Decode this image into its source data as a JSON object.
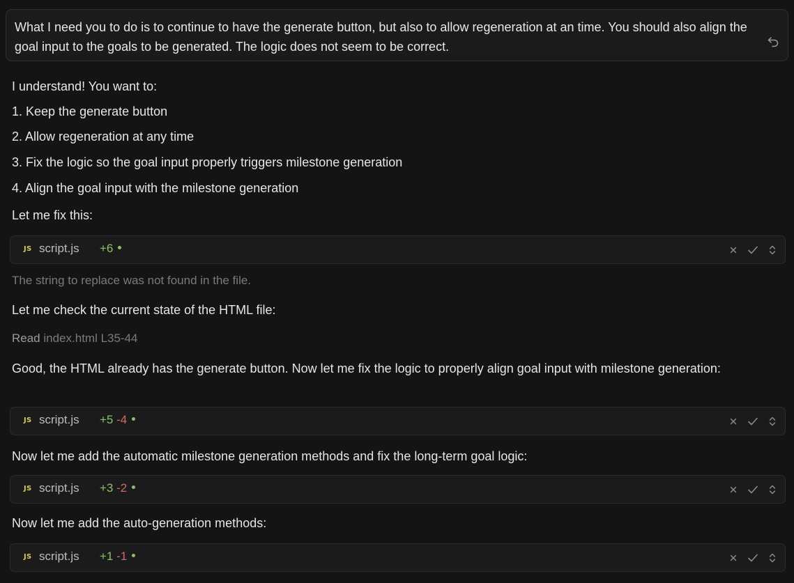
{
  "user_message": {
    "text": "What I need you to do is to continue to have the generate button, but also to allow regeneration at an time. You should also align the goal input to the goals to be generated. The logic does not seem to be correct."
  },
  "assistant": {
    "intro": "I understand! You want to:",
    "list": [
      "1. Keep the generate button",
      "2. Allow regeneration at any time",
      "3. Fix the logic so the goal input properly triggers milestone generation",
      "4. Align the goal input with the milestone generation"
    ],
    "fix_intro": "Let me fix this:",
    "error_text": "The string to replace was not found in the file.",
    "check_text": "Let me check the current state of the HTML file:",
    "read": {
      "verb": "Read",
      "file": "index.html L35-44"
    },
    "good_text": "Good, the HTML already has the generate button. Now let me fix the logic to properly align goal input with milestone generation:",
    "add_methods_text": "Now let me add the automatic milestone generation methods and fix the long-term goal logic:",
    "auto_gen_text": "Now let me add the auto-generation methods:"
  },
  "edits": [
    {
      "badge": "JS",
      "file": "script.js",
      "added": "+6",
      "removed": ""
    },
    {
      "badge": "JS",
      "file": "script.js",
      "added": "+5",
      "removed": "-4"
    },
    {
      "badge": "JS",
      "file": "script.js",
      "added": "+3",
      "removed": "-2"
    },
    {
      "badge": "JS",
      "file": "script.js",
      "added": "+1",
      "removed": "-1"
    }
  ],
  "icons": {
    "undo": "undo-icon",
    "reject": "close-icon",
    "accept": "check-icon",
    "expand": "expand-icon"
  },
  "colors": {
    "background": "#141414",
    "added": "#8cc06b",
    "removed": "#d16a6a",
    "js_badge": "#d8c861",
    "muted": "#7a7a7a"
  }
}
